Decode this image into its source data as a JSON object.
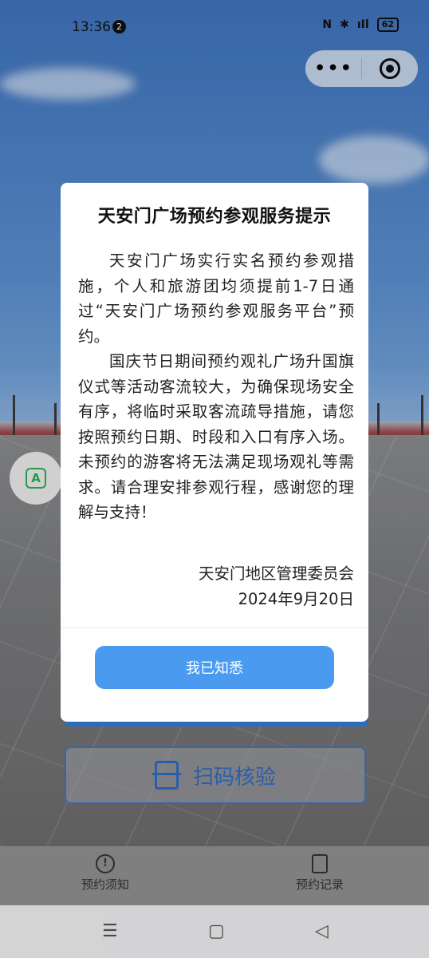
{
  "status_bar": {
    "time": "13:36",
    "notification_count": "2",
    "nfc": "N",
    "signal": "ıIl",
    "battery": "62"
  },
  "capsule": {
    "more_label": "•••"
  },
  "float_button": {
    "label": "A"
  },
  "modal": {
    "title": "天安门广场预约参观服务提示",
    "paragraph1": "天安门广场实行实名预约参观措施，个人和旅游团均须提前1-7日通过“天安门广场预约参观服务平台”预约。",
    "paragraph2": "国庆节日期间预约观礼广场升国旗仪式等活动客流较大，为确保现场安全有序，将临时采取客流疏导措施，请您按照预约日期、时段和入口有序入场。未预约的游客将无法满足现场观礼等需求。请合理安排参观行程，感谢您的理解与支持！",
    "signature_org": "天安门地区管理委员会",
    "signature_date": "2024年9月20日",
    "confirm_label": "我已知悉"
  },
  "scan_button": {
    "label": "扫码核验"
  },
  "tabbar": {
    "tabs": [
      {
        "label": "预约须知",
        "icon": "info-icon"
      },
      {
        "label": "预约记录",
        "icon": "record-icon"
      }
    ]
  },
  "navbar": {
    "menu": "☰",
    "home": "▢",
    "back": "◁"
  },
  "colors": {
    "primary_blue": "#4a9bef",
    "scan_blue": "#2f6bc0",
    "green": "#2bb24c"
  }
}
